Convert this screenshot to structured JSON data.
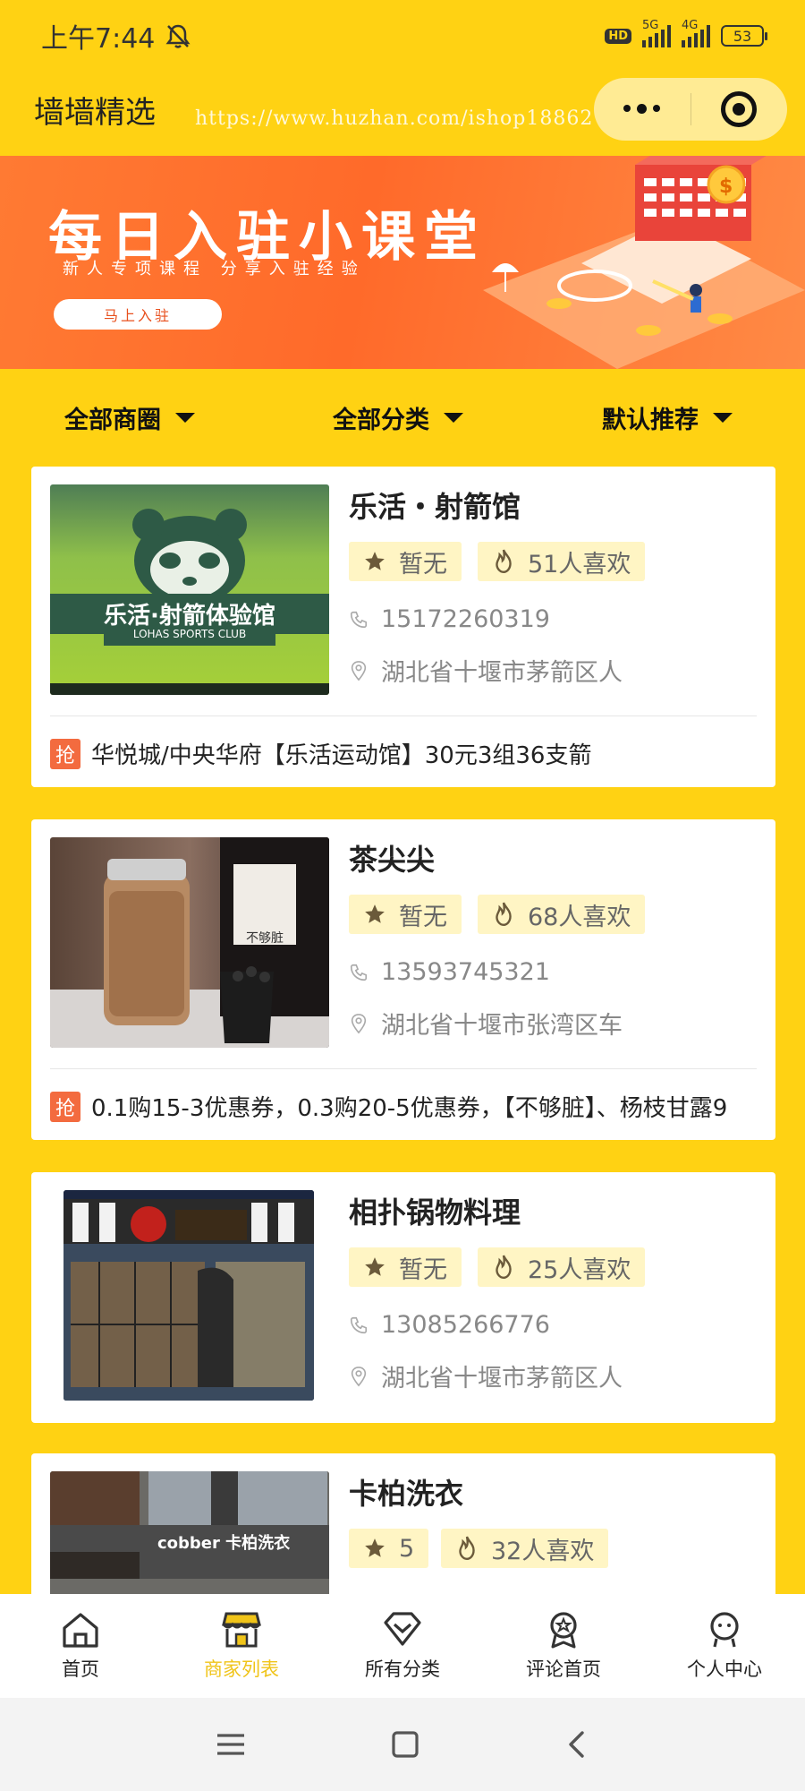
{
  "status": {
    "time": "上午7:44",
    "hd": "HD",
    "net1": "5G",
    "net2": "4G",
    "battery": "53"
  },
  "nav": {
    "title": "墙墙精选",
    "watermark": "https://www.huzhan.com/ishop18862"
  },
  "banner": {
    "title": "每日入驻小课堂",
    "subtitle": "新人专项课程   分享入驻经验",
    "button": "马上入驻"
  },
  "filters": [
    {
      "label": "全部商圈"
    },
    {
      "label": "全部分类"
    },
    {
      "label": "默认推荐"
    }
  ],
  "merchants": [
    {
      "name": "乐活・射箭馆",
      "rating": "暂无",
      "likes": "51人喜欢",
      "phone": "15172260319",
      "address": "湖北省十堰市茅箭区人",
      "promo_tag": "抢",
      "promo": "华悦城/中央华府【乐活运动馆】30元3组36支箭",
      "thumb_text": "乐活·射箭体验馆",
      "thumb_subtext": "LOHAS SPORTS CLUB"
    },
    {
      "name": "茶尖尖",
      "rating": "暂无",
      "likes": "68人喜欢",
      "phone": "13593745321",
      "address": "湖北省十堰市张湾区车",
      "promo_tag": "抢",
      "promo": "0.1购15-3优惠券，0.3购20-5优惠券，【不够脏】、杨枝甘露9",
      "thumb_text": "不够脏",
      "thumb_subtext": ""
    },
    {
      "name": "相扑锅物料理",
      "rating": "暂无",
      "likes": "25人喜欢",
      "phone": "13085266776",
      "address": "湖北省十堰市茅箭区人",
      "thumb_text": "",
      "thumb_subtext": ""
    },
    {
      "name": "卡柏洗衣",
      "rating": "5",
      "likes": "32人喜欢",
      "thumb_text": "cobber 卡柏洗衣",
      "thumb_subtext": ""
    }
  ],
  "tabbar": [
    {
      "label": "首页",
      "icon": "home-icon"
    },
    {
      "label": "商家列表",
      "icon": "store-icon"
    },
    {
      "label": "所有分类",
      "icon": "category-icon"
    },
    {
      "label": "评论首页",
      "icon": "badge-icon"
    },
    {
      "label": "个人中心",
      "icon": "user-icon"
    }
  ],
  "colors": {
    "brand": "#FFD213",
    "active_tab": "#F0C419",
    "tag_bg": "#FFF5C4",
    "promo_badge": "#F36B3F"
  }
}
